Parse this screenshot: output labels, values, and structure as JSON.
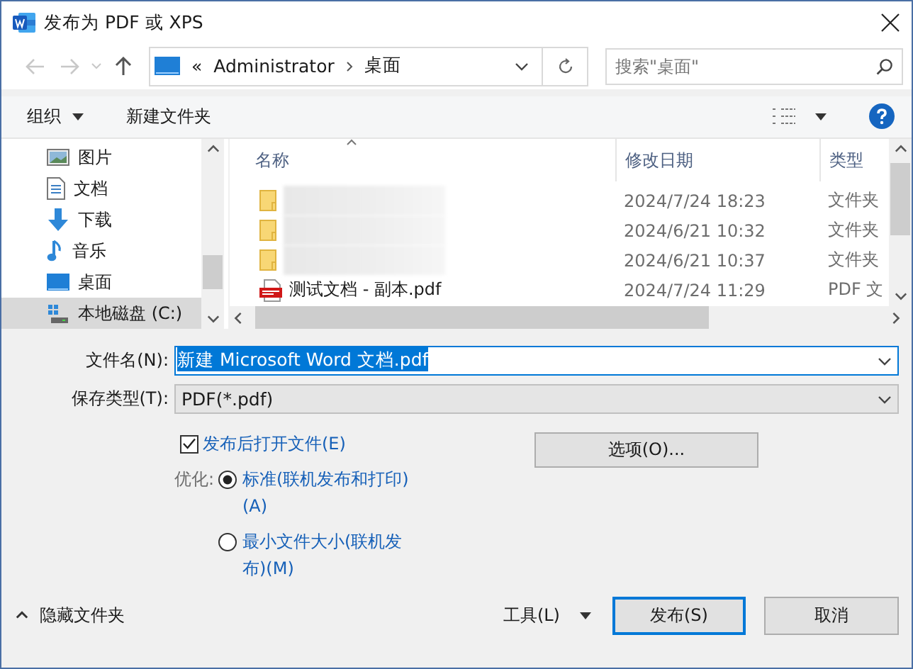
{
  "window": {
    "title": "发布为 PDF 或 XPS"
  },
  "navigation": {
    "overflow": "«",
    "path": [
      "Administrator",
      "桌面"
    ],
    "search": {
      "placeholder": "搜索\"桌面\""
    }
  },
  "toolbar": {
    "organize": "组织",
    "new_folder": "新建文件夹"
  },
  "sidebar": {
    "items": [
      {
        "kind": "pictures",
        "label": "图片",
        "selected": false
      },
      {
        "kind": "documents",
        "label": "文档",
        "selected": false
      },
      {
        "kind": "downloads",
        "label": "下载",
        "selected": false
      },
      {
        "kind": "music",
        "label": "音乐",
        "selected": false
      },
      {
        "kind": "desktop",
        "label": "桌面",
        "selected": false
      },
      {
        "kind": "drive",
        "label": "本地磁盘 (C:)",
        "selected": true
      }
    ]
  },
  "file_list": {
    "columns": [
      "名称",
      "修改日期",
      "类型"
    ],
    "rows": [
      {
        "kind": "folder",
        "modified": "2024/7/24 18:23",
        "type": "文件夹"
      },
      {
        "kind": "folder",
        "modified": "2024/6/21 10:32",
        "type": "文件夹"
      },
      {
        "kind": "folder",
        "modified": "2024/6/21 10:37",
        "type": "文件夹"
      },
      {
        "kind": "pdf",
        "name": "测试文档 - 副本.pdf",
        "modified": "2024/7/24 11:29",
        "type": "PDF 文"
      }
    ]
  },
  "form": {
    "file_name": {
      "label": "文件名(N):",
      "value": "新建 Microsoft Word 文档.pdf"
    },
    "save_type": {
      "label": "保存类型(T):",
      "value": "PDF(*.pdf)"
    }
  },
  "options": {
    "open_after": {
      "label": "发布后打开文件(E)",
      "checked": true
    },
    "options_button": "选项(O)...",
    "optimize_label": "优化:",
    "radios": [
      {
        "label": "标准(联机发布和打印)(A)",
        "selected": true
      },
      {
        "label": "最小文件大小(联机发布)(M)",
        "selected": false
      }
    ]
  },
  "footer": {
    "hide_folders": "隐藏文件夹",
    "tools": "工具(L)",
    "buttons": [
      {
        "kind": "default",
        "label": "发布(S)"
      },
      {
        "kind": "normal",
        "label": "取消"
      }
    ]
  }
}
